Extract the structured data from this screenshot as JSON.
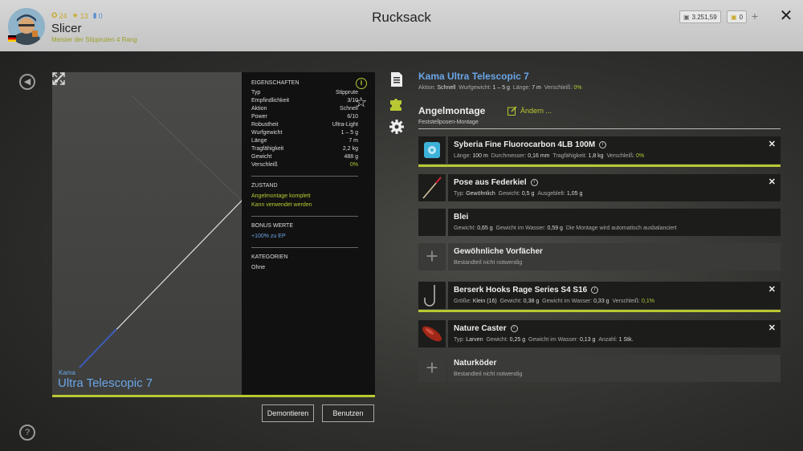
{
  "header": {
    "title": "Rucksack",
    "player_name": "Slicer",
    "player_rank": "Meister der Stippruten 4 Rang",
    "stats": [
      "24",
      "13",
      "0"
    ],
    "silver": "3.251,59",
    "gold": "0"
  },
  "rod": {
    "brand": "Kama",
    "model": "Ultra Telescopic 7"
  },
  "properties": {
    "title": "EIGENSCHAFTEN",
    "rows": [
      {
        "k": "Typ",
        "v": "Stipprute"
      },
      {
        "k": "Empfindlichkeit",
        "v": "3/10"
      },
      {
        "k": "Aktion",
        "v": "Schnell"
      },
      {
        "k": "Power",
        "v": "6/10"
      },
      {
        "k": "Robustheit",
        "v": "Ultra-Light"
      },
      {
        "k": "Wurfgewicht",
        "v": "1 – 5 g"
      },
      {
        "k": "Länge",
        "v": "7 m"
      },
      {
        "k": "Tragfähigkeit",
        "v": "2,2 kg"
      },
      {
        "k": "Gewicht",
        "v": "488 g"
      },
      {
        "k": "Verschleiß",
        "v": "0%"
      }
    ],
    "state_title": "ZUSTAND",
    "state_1": "Angelmontage komplett",
    "state_2": "Kann verwendet werden",
    "bonus_title": "BONUS WERTE",
    "bonus_1": "+100% zu EP",
    "cat_title": "KATEGORIEN",
    "cat_1": "Ohne"
  },
  "buttons": {
    "dismantle": "Demontieren",
    "use": "Benutzen"
  },
  "right": {
    "title": "Kama Ultra Telescopic 7",
    "sub": {
      "aktion_k": "Aktion:",
      "aktion_v": "Schnell",
      "wurf_k": "Wurfgewicht:",
      "wurf_v": "1 – 5 g",
      "laenge_k": "Länge:",
      "laenge_v": "7 m",
      "versch_k": "Verschleiß:",
      "versch_v": "0%"
    },
    "section_title": "Angelmontage",
    "section_sub": "Feststellposen-Montage",
    "edit": "Ändern ..."
  },
  "items": [
    {
      "name": "Syberia Fine Fluorocarbon 4LB 100M",
      "d": [
        [
          "Länge:",
          "100 m"
        ],
        [
          "Durchmesser:",
          "0,16 mm"
        ],
        [
          "Tragfähigkeit:",
          "1,8 kg"
        ],
        [
          "Verschleiß:",
          "0%"
        ]
      ]
    },
    {
      "name": "Pose aus Federkiel",
      "d": [
        [
          "Typ:",
          "Gewöhnlich"
        ],
        [
          "Gewicht:",
          "0,5 g"
        ],
        [
          "Ausgeblelt:",
          "1,05 g"
        ]
      ]
    },
    {
      "name": "Blei",
      "d": [
        [
          "Gewicht:",
          "0,65 g"
        ],
        [
          "Gewicht im Wasser:",
          "0,59 g"
        ],
        [
          "Die Montage wird automatisch ausbalanciert",
          ""
        ]
      ]
    },
    {
      "name": "Gewöhnliche Vorfächer",
      "d": [
        [
          "Bestandteil nicht notwendig",
          ""
        ]
      ]
    },
    {
      "name": "Berserk Hooks Rage Series S4 S16",
      "d": [
        [
          "Größe:",
          "Klein (16)"
        ],
        [
          "Gewicht:",
          "0,38 g"
        ],
        [
          "Gewicht im Wasser:",
          "0,33 g"
        ],
        [
          "Verschleiß:",
          "0,1%"
        ]
      ]
    },
    {
      "name": "Nature Caster",
      "d": [
        [
          "Typ:",
          "Larven"
        ],
        [
          "Gewicht:",
          "0,25 g"
        ],
        [
          "Gewicht im Wasser:",
          "0,13 g"
        ],
        [
          "Anzahl:",
          "1 Stk."
        ]
      ]
    },
    {
      "name": "Naturköder",
      "d": [
        [
          "Bestandteil nicht notwendig",
          ""
        ]
      ]
    }
  ],
  "colors": {
    "accent": "#b8c832",
    "link": "#6aa6e6"
  }
}
